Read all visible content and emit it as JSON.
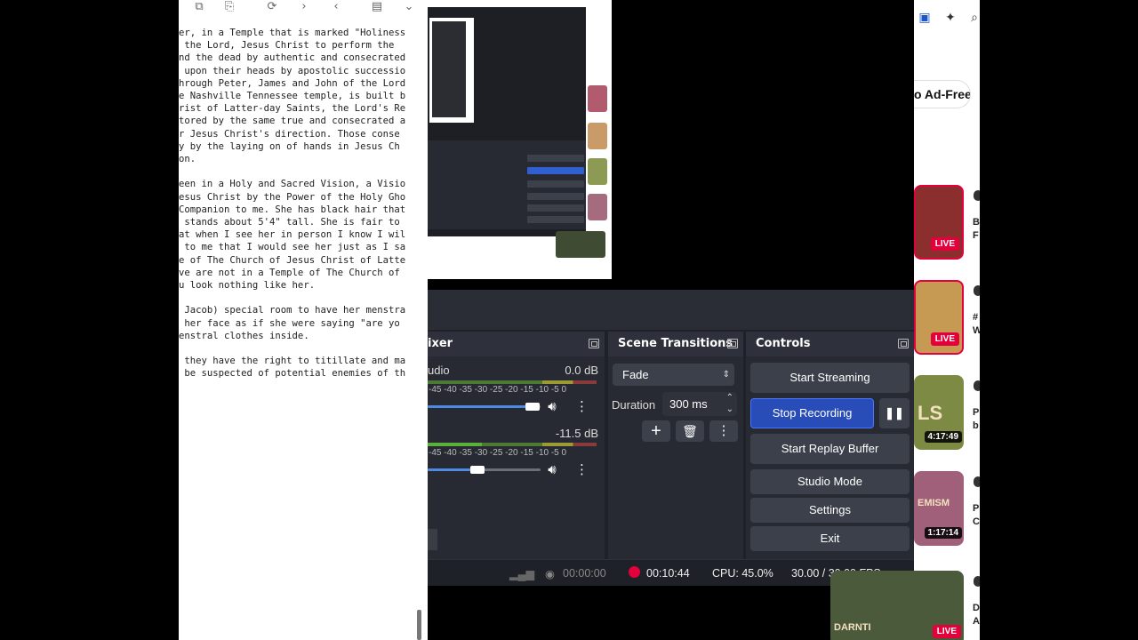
{
  "editor": {
    "lines": [
      "er, in a Temple that is marked \"Holiness",
      " the Lord, Jesus Christ to perform the",
      "nd the dead by authentic and consecrated",
      " upon their heads by apostolic successio",
      "hrough Peter, James and John of the Lord",
      "e Nashville Tennessee temple, is built b",
      "rist of Latter-day Saints, the Lord's Re",
      "tored by the same true and consecrated a",
      "r Jesus Christ's direction. Those conse",
      "y by the laying on of hands in Jesus Ch",
      "on.",
      "",
      "een in a Holy and Sacred Vision, a Visio",
      "esus Christ by the Power of the Holy Gho",
      "Companion to me. She has black hair that",
      " stands about 5'4\" tall. She is fair to",
      "at when I see her in person I know I wil",
      " to me that I would see her just as I sa",
      "e of The Church of Jesus Christ of Latte",
      "ve are not in a Temple of The Church of",
      "u look nothing like her.",
      "",
      " Jacob) special room to have her menstra",
      " her face as if she were saying \"are yo",
      "enstral clothes inside.",
      "",
      " they have the right to titillate and ma",
      " be suspected of potential enemies of th"
    ]
  },
  "obs": {
    "mixer": {
      "title": "ixer",
      "track1": {
        "name": "udio",
        "db": "0.0 dB",
        "level": 0.95
      },
      "track2": {
        "db": "-11.5 dB",
        "level": 0.3
      },
      "scale": [
        "-45",
        "-40",
        "-35",
        "-30",
        "-25",
        "-20",
        "-15",
        "-10",
        "-5",
        "0"
      ]
    },
    "transitions": {
      "title": "Scene Transitions",
      "selected": "Fade",
      "duration_label": "Duration",
      "duration_value": "300 ms"
    },
    "controls": {
      "title": "Controls",
      "start_streaming": "Start Streaming",
      "stop_recording": "Stop Recording",
      "start_replay": "Start Replay Buffer",
      "studio_mode": "Studio Mode",
      "settings": "Settings",
      "exit": "Exit"
    },
    "status": {
      "stream_time": "00:00:00",
      "rec_time": "00:10:44",
      "cpu": "CPU: 45.0%",
      "fps": "30.00 / 30.00 FPS"
    }
  },
  "browser": {
    "ad_free": "o Ad-Free",
    "thumbs": [
      {
        "badge": "LIVE",
        "kind": "live",
        "side": "B",
        "side2": "F",
        "color": "#8a2e2e"
      },
      {
        "badge": "LIVE",
        "kind": "live",
        "side": "#",
        "side2": "W",
        "color": "#c79a54"
      },
      {
        "badge": "4:17:49",
        "kind": "dur",
        "side": "P",
        "side2": "b",
        "color": "#7d8a43"
      },
      {
        "badge": "1:17:14",
        "kind": "dur",
        "side": "P",
        "side2": "C",
        "color": "#a0607a"
      },
      {
        "badge": "LIVE",
        "kind": "live",
        "side": "D",
        "side2": "A",
        "color": "#4b5a3a"
      }
    ],
    "thumb_text": [
      "",
      "",
      "LS",
      "EMISM",
      "DARNTI"
    ]
  },
  "colors": {
    "accent": "#284cb8",
    "rec": "#e4003a",
    "obs_bg": "#272a33"
  }
}
